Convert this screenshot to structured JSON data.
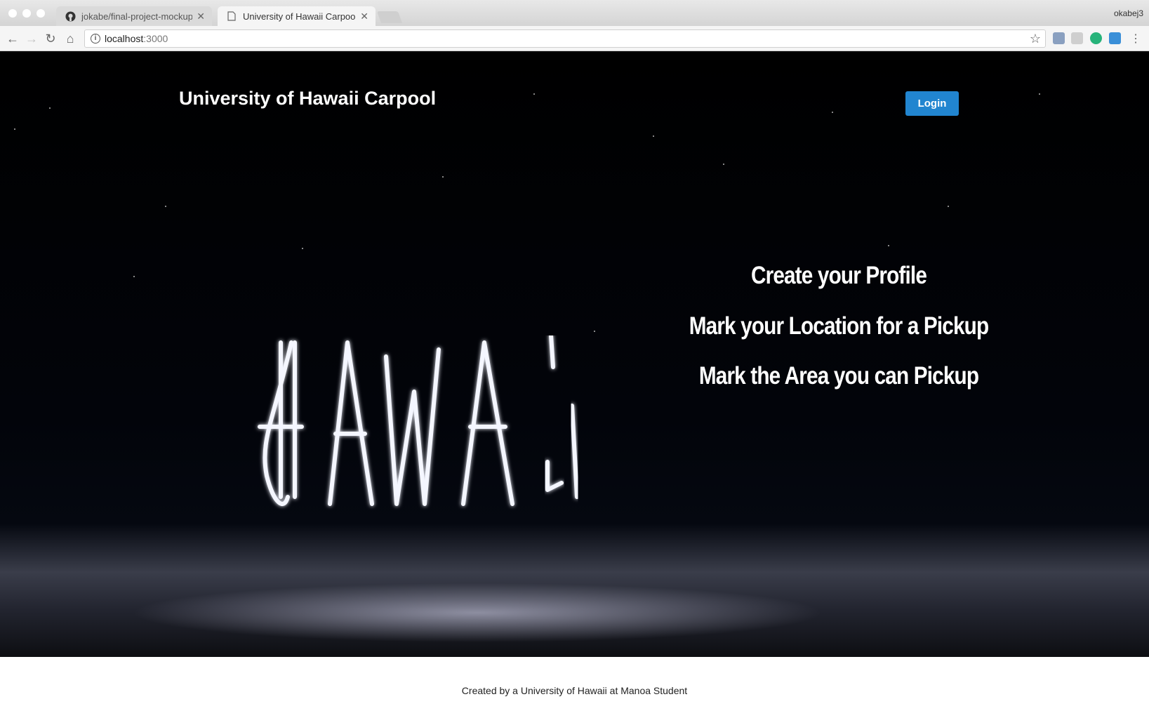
{
  "browser": {
    "tabs": [
      {
        "title": "jokabe/final-project-mockup",
        "icon": "github-icon",
        "active": false
      },
      {
        "title": "University of Hawaii Carpool",
        "icon": "page-icon",
        "active": true
      }
    ],
    "profile_name": "okabej3",
    "address": {
      "host": "localhost",
      "port": ":3000"
    }
  },
  "header": {
    "title": "University of Hawaii Carpool",
    "login_label": "Login"
  },
  "hero": {
    "features": [
      "Create your Profile",
      "Mark your Location for a Pickup",
      "Mark the Area you can Pickup"
    ],
    "background_text": "HAWAii"
  },
  "footer": {
    "text": "Created by a University of Hawaii at Manoa Student"
  },
  "colors": {
    "login_button": "#2185d0",
    "hero_background": "#02040a"
  }
}
